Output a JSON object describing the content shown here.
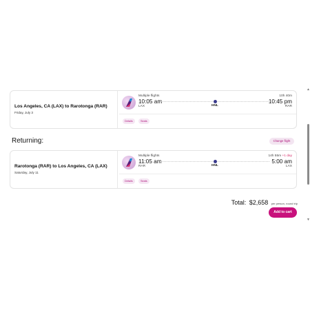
{
  "outbound": {
    "route": "Los Angeles, CA (LAX) to Rarotonga (RAR)",
    "date": "Friday, July 3",
    "multiple_flights": "Multiple flights",
    "depart_time": "10:05 am",
    "depart_code": "LAX",
    "stop_code": "HNL",
    "duration": "10h 40m",
    "arrive_time": "10:45 pm",
    "arrive_code": "RAR",
    "details_label": "Details",
    "seats_label": "Seats"
  },
  "returning_heading": "Returning:",
  "change_flight_label": "Change flight",
  "return": {
    "route": "Rarotonga (RAR) to Los Angeles, CA (LAX)",
    "date": "Saturday, July 11",
    "multiple_flights": "Multiple flights",
    "depart_time": "11:05 am",
    "depart_code": "RAR",
    "stop_code": "HNL",
    "duration": "14h 55m",
    "plus_day": "+1 day",
    "arrive_time": "5:00 am",
    "arrive_code": "LAX",
    "details_label": "Details",
    "seats_label": "Seats"
  },
  "total": {
    "label": "Total:",
    "amount": "$2,658",
    "per": "per person, round trip"
  },
  "add_to_cart_label": "Add to cart",
  "colors": {
    "accent": "#c8117c",
    "chip_bg": "#f5e6f3",
    "stop_dot": "#3a3a8c"
  },
  "icons": {
    "airline_logo": "airline-tail-logo",
    "scroll_up": "scroll-up-arrow-icon",
    "scroll_down": "scroll-down-arrow-icon"
  }
}
